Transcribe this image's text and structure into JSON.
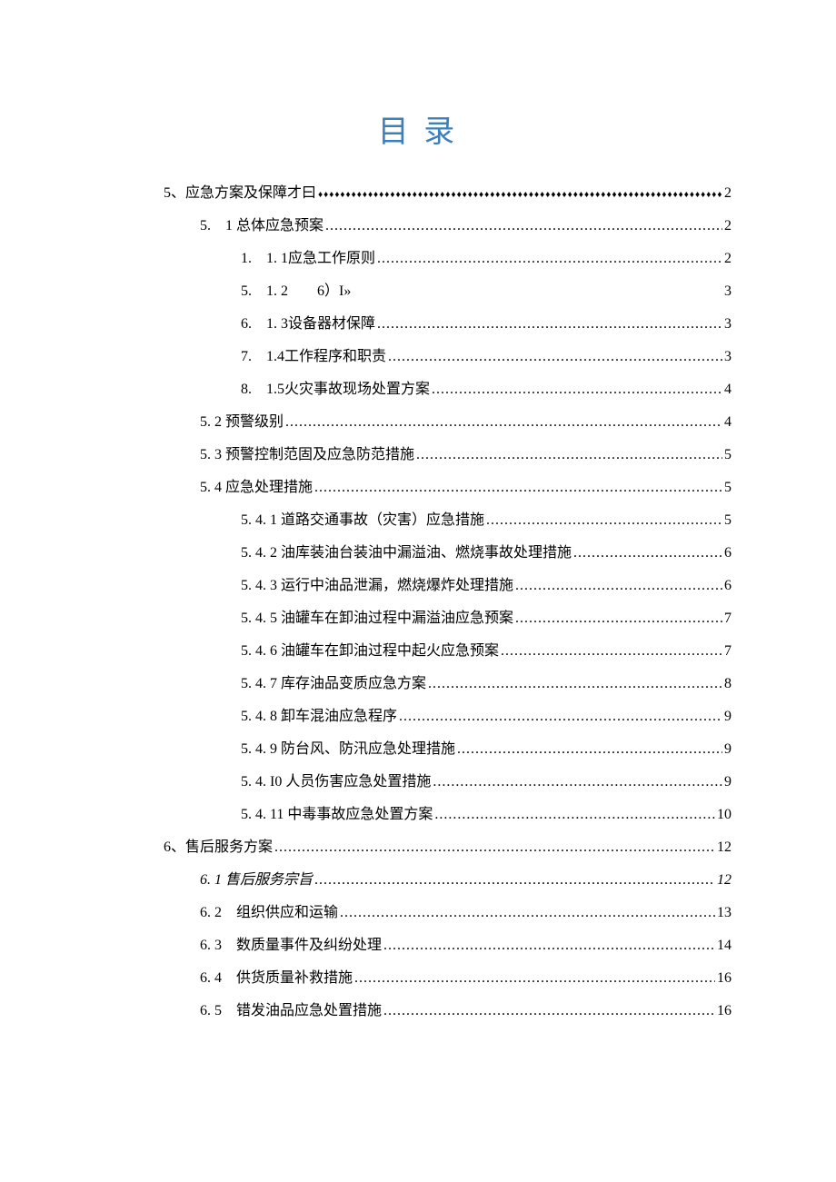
{
  "title": "目 录",
  "leaders": {
    "diamond": "♦♦♦♦♦♦♦♦♦♦♦♦♦♦♦♦♦♦♦♦♦♦♦♦♦♦♦♦♦♦♦♦♦♦♦♦♦♦♦♦♦♦♦♦♦♦♦♦♦♦♦♦♦♦♦♦♦♦♦♦♦♦♦♦♦♦♦♦♦♦♦♦♦♦♦♦♦♦♦♦♦♦♦♦♦♦♦♦♦♦",
    "dot": "..................................................................................................................................."
  },
  "entries": [
    {
      "indent": 0,
      "label": "5、应急方案及保障才曰",
      "leader": "diamond",
      "page": "2",
      "style": ""
    },
    {
      "indent": 1,
      "label": "5.　1 总体应急预案",
      "leader": "dot",
      "page": "2",
      "style": ""
    },
    {
      "indent": 2,
      "label": "1.　1. 1应急工作原则",
      "leader": "dot",
      "page": "2",
      "style": ""
    },
    {
      "indent": 2,
      "label": "5.　1. 2　　6）I»",
      "leader": "none",
      "page": "3",
      "style": ""
    },
    {
      "indent": 2,
      "label": "6.　1. 3设备器材保障",
      "leader": "dot",
      "page": "3",
      "style": ""
    },
    {
      "indent": 2,
      "label": "7.　1.4工作程序和职责",
      "leader": "dot",
      "page": "3",
      "style": ""
    },
    {
      "indent": 2,
      "label": "8.　1.5火灾事故现场处置方案",
      "leader": "dot",
      "page": "4",
      "style": ""
    },
    {
      "indent": 1,
      "label": "5. 2 预警级别",
      "leader": "dot",
      "page": "4",
      "style": ""
    },
    {
      "indent": 1,
      "label": "5. 3 预警控制范固及应急防范措施",
      "leader": "dot",
      "page": "5",
      "style": ""
    },
    {
      "indent": 1,
      "label": "5. 4 应急处理措施",
      "leader": "dot",
      "page": "5",
      "style": ""
    },
    {
      "indent": 2,
      "label": "5. 4. 1 道路交通事故（灾害）应急措施",
      "leader": "dot",
      "page": "5",
      "style": ""
    },
    {
      "indent": 2,
      "label": "5. 4. 2 油库装油台装油中漏溢油、燃烧事故处理措施",
      "leader": "dot",
      "page": "6",
      "style": ""
    },
    {
      "indent": 2,
      "label": "5. 4. 3 运行中油品泄漏，燃烧爆炸处理措施",
      "leader": "dot",
      "page": "6",
      "style": ""
    },
    {
      "indent": 2,
      "label": "5. 4. 5 油罐车在卸油过程中漏溢油应急预案",
      "leader": "dot",
      "page": "7",
      "style": ""
    },
    {
      "indent": 2,
      "label": "5. 4. 6 油罐车在卸油过程中起火应急预案",
      "leader": "dot",
      "page": "7",
      "style": ""
    },
    {
      "indent": 2,
      "label": "5. 4. 7 库存油品变质应急方案",
      "leader": "dot",
      "page": "8",
      "style": ""
    },
    {
      "indent": 2,
      "label": "5. 4. 8 卸车混油应急程序",
      "leader": "dot",
      "page": "9",
      "style": ""
    },
    {
      "indent": 2,
      "label": "5. 4. 9 防台风、防汛应急处理措施",
      "leader": "dot",
      "page": "9",
      "style": ""
    },
    {
      "indent": 2,
      "label": "5. 4. I0 人员伤害应急处置措施",
      "leader": "dot",
      "page": "9",
      "style": ""
    },
    {
      "indent": 2,
      "label": "5. 4. 11 中毒事故应急处置方案",
      "leader": "dot",
      "page": "10",
      "style": ""
    },
    {
      "indent": 0,
      "label": "6、售后服务方案",
      "leader": "dot",
      "page": "12",
      "style": ""
    },
    {
      "indent": 1,
      "label": "6. 1 售后服务宗旨",
      "leader": "dot",
      "page": "12",
      "style": "italic"
    },
    {
      "indent": 1,
      "label": "6. 2　组织供应和运输",
      "leader": "dot",
      "page": "13",
      "style": ""
    },
    {
      "indent": 1,
      "label": "6. 3　数质量事件及纠纷处理",
      "leader": "dot",
      "page": "14",
      "style": ""
    },
    {
      "indent": 1,
      "label": "6. 4　供货质量补救措施",
      "leader": "dot",
      "page": "16",
      "style": ""
    },
    {
      "indent": 1,
      "label": "6. 5　错发油品应急处置措施",
      "leader": "dot",
      "page": "16",
      "style": ""
    }
  ]
}
